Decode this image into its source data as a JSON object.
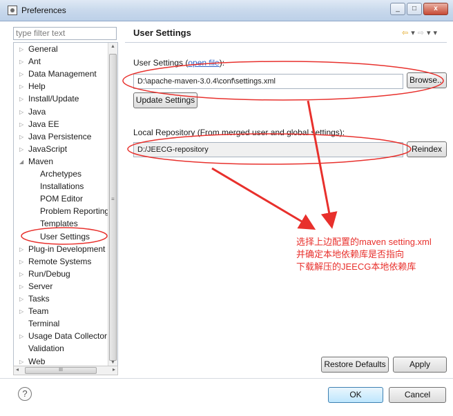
{
  "window": {
    "title": "Preferences",
    "controls": [
      "_",
      "□",
      "x"
    ]
  },
  "filter": {
    "placeholder": "type filter text"
  },
  "tree": {
    "items": [
      {
        "label": "General",
        "arrow": "▷"
      },
      {
        "label": "Ant",
        "arrow": "▷"
      },
      {
        "label": "Data Management",
        "arrow": "▷"
      },
      {
        "label": "Help",
        "arrow": "▷"
      },
      {
        "label": "Install/Update",
        "arrow": "▷"
      },
      {
        "label": "Java",
        "arrow": "▷"
      },
      {
        "label": "Java EE",
        "arrow": "▷"
      },
      {
        "label": "Java Persistence",
        "arrow": "▷"
      },
      {
        "label": "JavaScript",
        "arrow": "▷"
      },
      {
        "label": "Maven",
        "arrow": "◢"
      },
      {
        "label": "Archetypes"
      },
      {
        "label": "Installations"
      },
      {
        "label": "POM Editor"
      },
      {
        "label": "Problem Reporting"
      },
      {
        "label": "Templates"
      },
      {
        "label": "User Settings"
      },
      {
        "label": "Plug-in Development",
        "arrow": "▷"
      },
      {
        "label": "Remote Systems",
        "arrow": "▷"
      },
      {
        "label": "Run/Debug",
        "arrow": "▷"
      },
      {
        "label": "Server",
        "arrow": "▷"
      },
      {
        "label": "Tasks",
        "arrow": "▷"
      },
      {
        "label": "Team",
        "arrow": "▷"
      },
      {
        "label": "Terminal"
      },
      {
        "label": "Usage Data Collector",
        "arrow": "▷"
      },
      {
        "label": "Validation"
      },
      {
        "label": "Web",
        "arrow": "▷"
      }
    ],
    "hscroll_label": "III"
  },
  "page": {
    "title": "User Settings",
    "user_settings_label": "User Settings (",
    "open_file_link": "open file",
    "user_settings_label_end": "):",
    "settings_path": "D:\\apache-maven-3.0.4\\conf\\settings.xml",
    "browse_button": "Browse...",
    "update_button": "Update Settings",
    "local_repo_label": "Local Repository (From merged user and global settings):",
    "local_repo_path": "D:/JEECG-repository",
    "reindex_button": "Reindex",
    "restore_defaults_button": "Restore Defaults",
    "apply_button": "Apply"
  },
  "annotation": {
    "lines": [
      "选择上边配置的maven setting.xml",
      "并确定本地依赖库是否指向",
      "下载解压的JEECG本地依赖库"
    ],
    "color": "#e8302c"
  },
  "footer": {
    "help": "?",
    "ok_button": "OK",
    "cancel_button": "Cancel"
  }
}
